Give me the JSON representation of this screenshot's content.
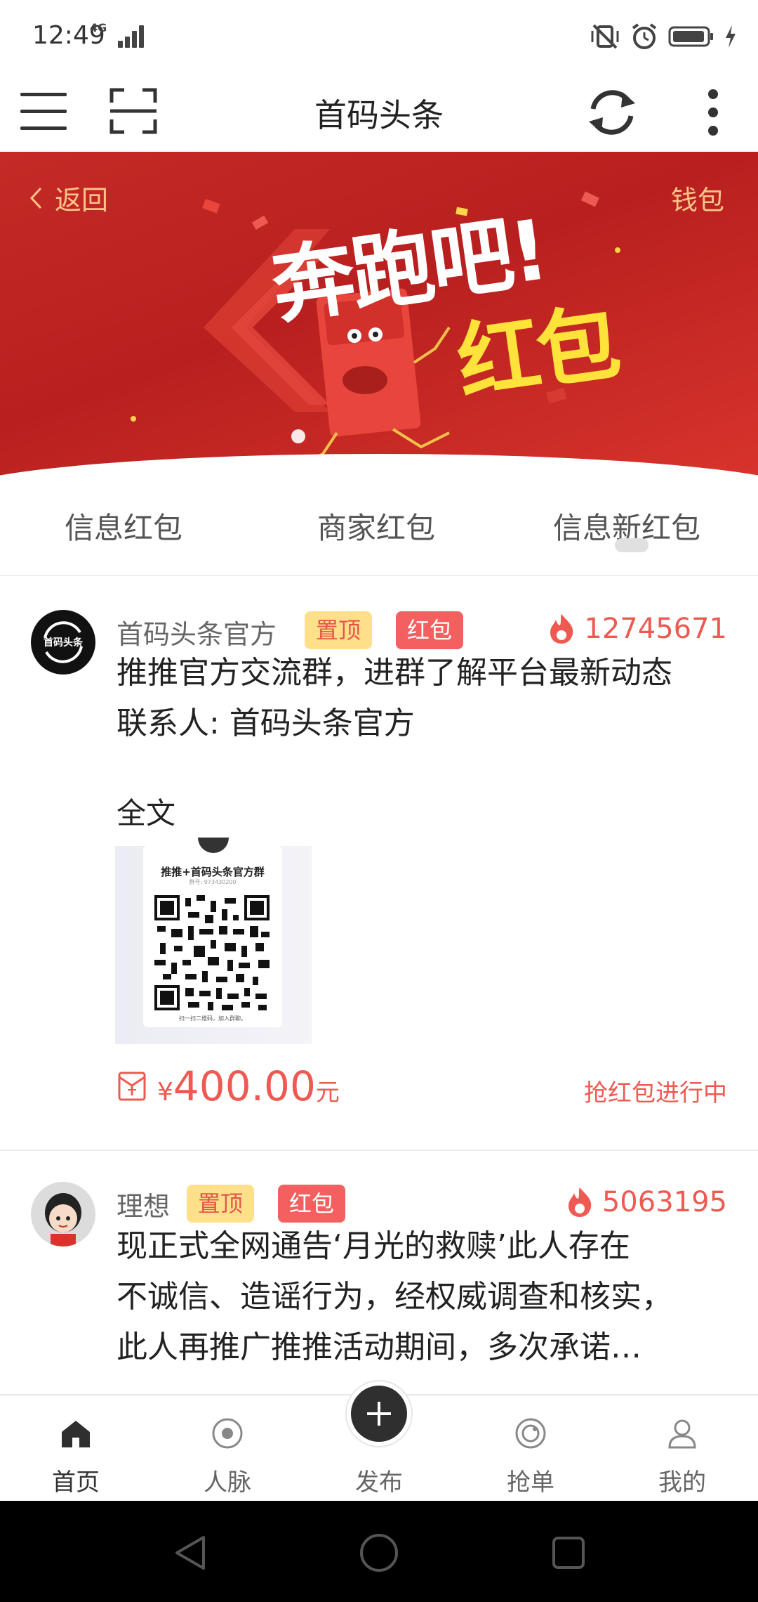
{
  "status_bar": {
    "time": "12:49",
    "network": "4G"
  },
  "header": {
    "title": "首码头条"
  },
  "banner": {
    "back_label": "返回",
    "wallet_label": "钱包",
    "headline_1": "奔跑吧!",
    "headline_2": "红包"
  },
  "tabs": [
    "信息红包",
    "商家红包",
    "信息新红包"
  ],
  "posts": [
    {
      "author": "首码头条官方",
      "avatar_text": "首码头条",
      "tag_pinned": "置顶",
      "tag_redpacket": "红包",
      "hot_count": "12745671",
      "text_line_1": "推推官方交流群，进群了解平台最新动态",
      "text_line_2": "联系人: 首码头条官方",
      "fulltext_label": "全文",
      "qr_title": "推推+首码头条官方群",
      "qr_sub": "群号: 973430200",
      "qr_foot": "扫一扫二维码，加入群聊。",
      "currency": "¥",
      "amount": "400.00",
      "unit": "元",
      "status": "抢红包进行中"
    },
    {
      "author": "理想",
      "tag_pinned": "置顶",
      "tag_redpacket": "红包",
      "hot_count": "5063195",
      "text_line_1": "现正式全网通告‘月光的救赎’此人存在",
      "text_line_2": "不诚信、造谣行为，经权威调查和核实，",
      "text_line_3": "此人再推广推推活动期间，多次承诺…"
    }
  ],
  "bottom_nav": {
    "items": [
      "首页",
      "人脉",
      "发布",
      "抢单",
      "我的"
    ],
    "active_index": 0
  },
  "colors": {
    "accent_red": "#ee5a52",
    "banner_red": "#c42a26",
    "pinned_bg": "#ffe08a",
    "banner_link": "#ffc48a"
  }
}
